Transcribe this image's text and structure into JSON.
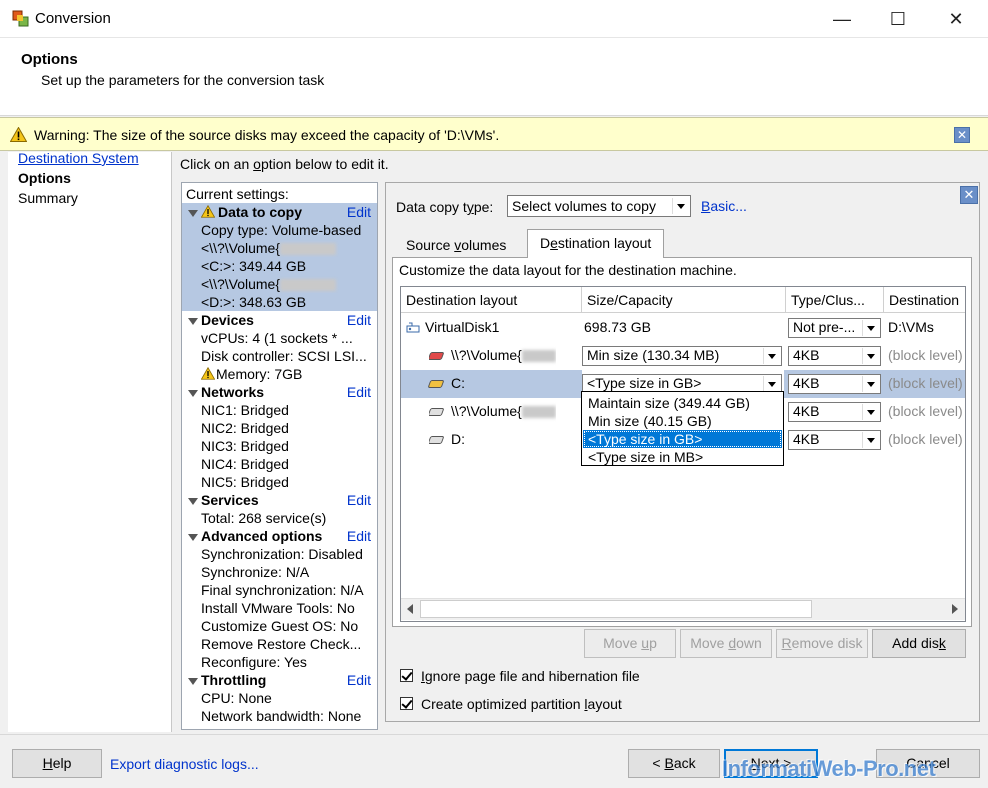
{
  "window": {
    "title": "Conversion",
    "minimize_glyph": "—",
    "maximize_glyph": "☐",
    "close_glyph": "✕"
  },
  "header": {
    "title": "Options",
    "subtitle": "Set up the parameters for the conversion task"
  },
  "warning": {
    "icon": "warning-icon",
    "text": "Warning: The size of the source disks may exceed the capacity of 'D:\\VMs'."
  },
  "nav": {
    "items": [
      "Destination System",
      "Options",
      "Summary"
    ]
  },
  "instruction": "Click on an option below to edit it.",
  "settings": {
    "title": "Current settings:",
    "edit_label": "Edit",
    "sections": [
      {
        "name": "Data to copy",
        "lines": [
          "Copy type: Volume-based",
          "<\\\\?\\Volume{",
          "<C:>: 349.44 GB",
          "<\\\\?\\Volume{",
          "<D:>: 348.63 GB"
        ]
      },
      {
        "name": "Devices",
        "lines": [
          "vCPUs: 4 (1 sockets * ...",
          "Disk controller: SCSI LSI...",
          "Memory: 7GB"
        ]
      },
      {
        "name": "Networks",
        "lines": [
          "NIC1: Bridged",
          "NIC2: Bridged",
          "NIC3: Bridged",
          "NIC4: Bridged",
          "NIC5: Bridged"
        ]
      },
      {
        "name": "Services",
        "lines": [
          "Total: 268 service(s)"
        ]
      },
      {
        "name": "Advanced options",
        "lines": [
          "Synchronization: Disabled",
          "Synchronize: N/A",
          "Final synchronization: N/A",
          "Install VMware Tools: No",
          "Customize Guest OS: No",
          "Remove Restore Check...",
          "Reconfigure: Yes"
        ]
      },
      {
        "name": "Throttling",
        "lines": [
          "CPU: None",
          "Network bandwidth: None"
        ]
      }
    ]
  },
  "panel": {
    "data_copy_type_label": "Data copy type:",
    "data_copy_type_value": "Select volumes to copy",
    "basic_link": "Basic...",
    "tabs": [
      "Source volumes",
      "Destination layout"
    ],
    "description": "Customize the data layout for the destination machine.",
    "columns": [
      "Destination layout",
      "Size/Capacity",
      "Type/Clus...",
      "Destination"
    ],
    "rows": [
      {
        "name": "VirtualDisk1",
        "size": "698.73 GB",
        "type": "Not pre-...",
        "dest": "D:\\VMs"
      },
      {
        "name": "\\\\?\\Volume{",
        "size": "Min size (130.34 MB)",
        "type": "4KB",
        "dest": "(block level)"
      },
      {
        "name": "C:",
        "size": "<Type size in GB>",
        "type": "4KB",
        "dest": "(block level)"
      },
      {
        "name": "\\\\?\\Volume{",
        "size": "",
        "type": "4KB",
        "dest": "(block level)"
      },
      {
        "name": "D:",
        "size": "",
        "type": "4KB",
        "dest": "(block level)"
      }
    ],
    "dropdown_options": [
      "Maintain size (349.44 GB)",
      "Min size (40.15 GB)",
      "<Type size in GB>",
      "<Type size in MB>"
    ],
    "dropdown_selected_index": 2,
    "buttons": {
      "move_up": "Move up",
      "move_down": "Move down",
      "remove_disk": "Remove disk",
      "add_disk": "Add disk"
    },
    "checkboxes": [
      {
        "label": "Ignore page file and hibernation file",
        "checked": true
      },
      {
        "label": "Create optimized partition layout",
        "checked": true
      }
    ]
  },
  "footer": {
    "help": "Help",
    "export_logs": "Export diagnostic logs...",
    "back": "< Back",
    "next": "Next >",
    "cancel": "Cancel"
  },
  "watermark": "InformatiWeb-Pro.net"
}
